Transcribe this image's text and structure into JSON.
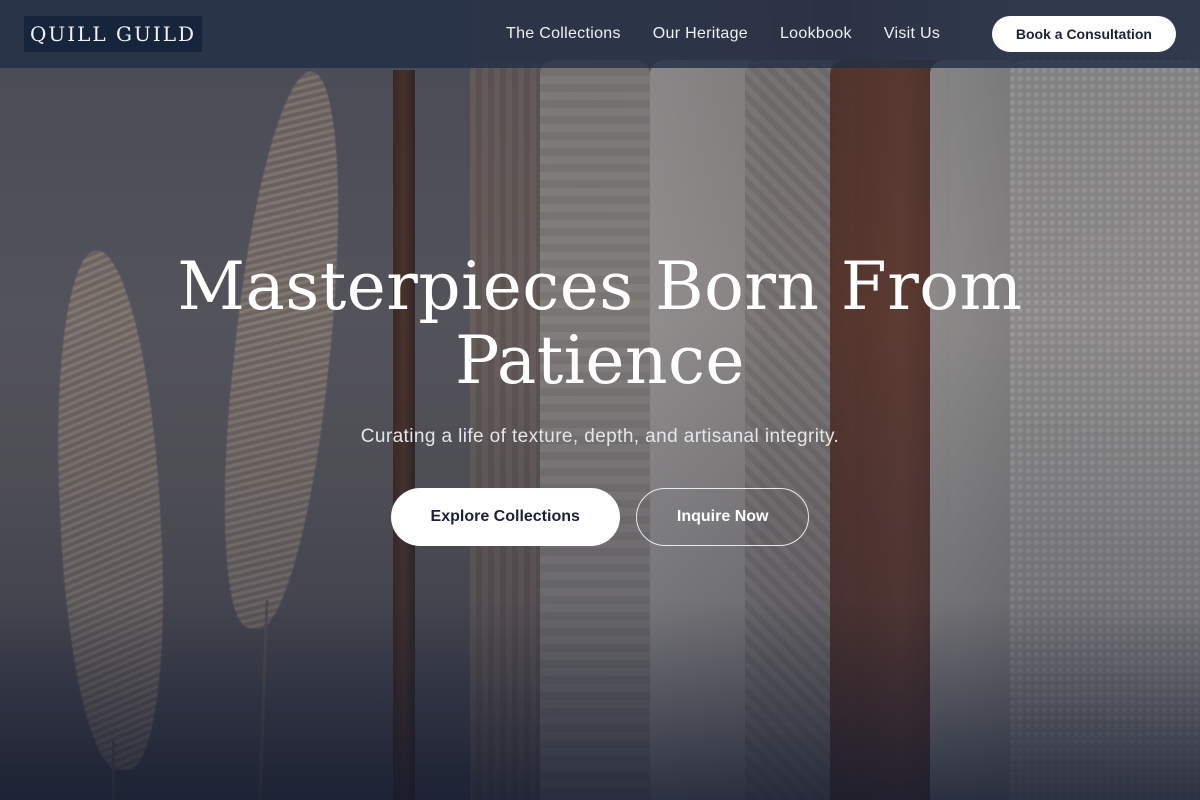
{
  "header": {
    "logo_text": "QUILL GUILD",
    "nav": [
      {
        "label": "The Collections"
      },
      {
        "label": "Our Heritage"
      },
      {
        "label": "Lookbook"
      },
      {
        "label": "Visit Us"
      }
    ],
    "cta_label": "Book a Consultation"
  },
  "hero": {
    "title": "Masterpieces Born From Patience",
    "subtitle": "Curating a life of texture, depth, and artisanal integrity.",
    "primary_button": "Explore Collections",
    "secondary_button": "Inquire Now"
  },
  "colors": {
    "header_bg": "#23304620",
    "logo_bg": "#16243c",
    "text_light": "#ffffff",
    "button_text_dark": "#1a2236"
  }
}
